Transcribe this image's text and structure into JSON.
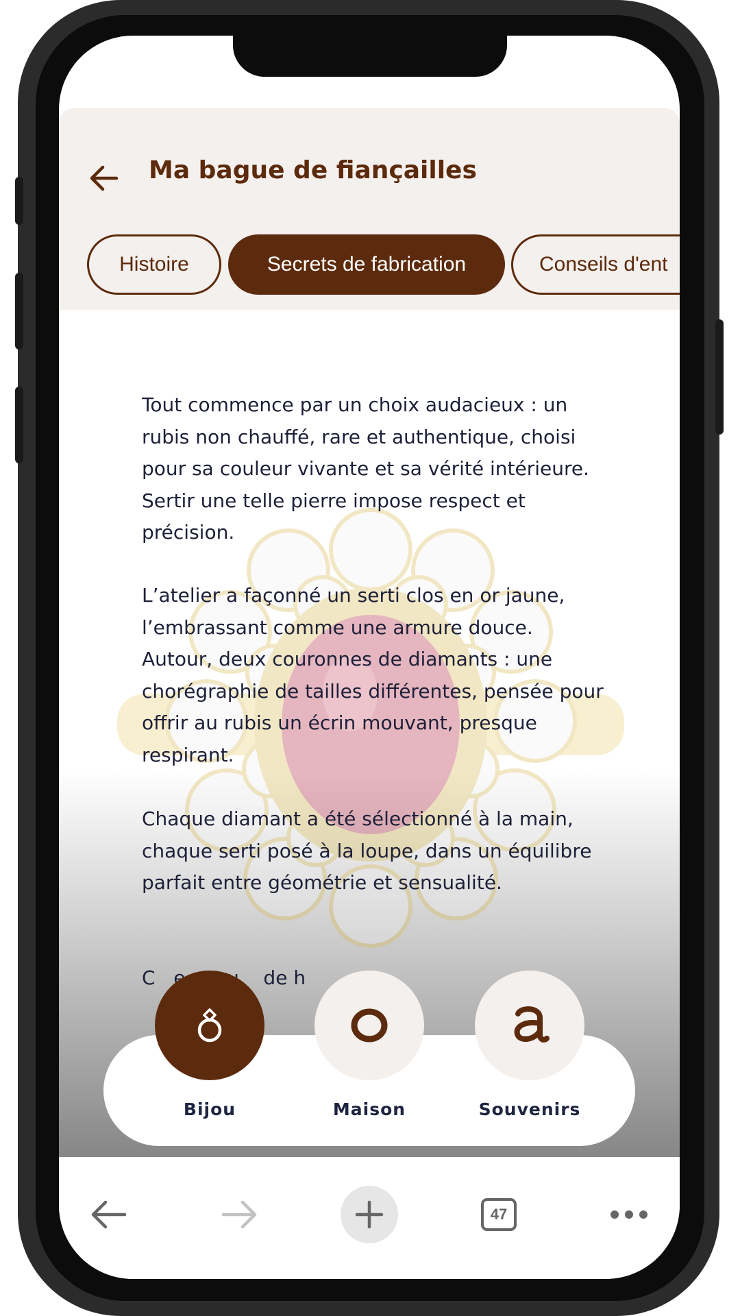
{
  "header": {
    "title": "Ma bague de fiançailles"
  },
  "tabs": [
    {
      "label": "Histoire",
      "active": false
    },
    {
      "label": "Secrets de fabrication",
      "active": true
    },
    {
      "label": "Conseils d'ent",
      "active": false
    }
  ],
  "article": {
    "paragraphs": [
      "Tout commence par un choix audacieux : un rubis non chauffé, rare et authentique, choisi pour sa couleur vivante et sa vérité intérieure. Sertir une telle pierre impose respect et précision.",
      "L’atelier a façonné un serti clos en or jaune, l’embrassant comme une armure douce. Autour, deux couronnes de diamants : une chorégraphie de tailles différentes, pensée pour offrir au rubis un écrin mouvant, presque respirant.",
      "Chaque diamant a été sélectionné à la main, chaque serti posé à la loupe, dans un équilibre parfait entre géométrie et sensualité.",
      "C   e est u    de h"
    ]
  },
  "bottom_nav": {
    "items": [
      {
        "label": "Bijou",
        "icon": "ring-icon",
        "active": true
      },
      {
        "label": "Maison",
        "icon": "o-letter-icon",
        "active": false
      },
      {
        "label": "Souvenirs",
        "icon": "a-letter-icon",
        "active": false
      }
    ]
  },
  "browser": {
    "tab_count": "47",
    "buttons": [
      "back-icon",
      "forward-icon",
      "new-tab-icon",
      "tabs-icon",
      "more-icon"
    ]
  },
  "colors": {
    "brand_brown": "#5c2a0c",
    "header_bg": "#f4f0ed",
    "text_dark": "#1d2038",
    "ruby": "#b0203c",
    "gold": "#d9b84a"
  }
}
